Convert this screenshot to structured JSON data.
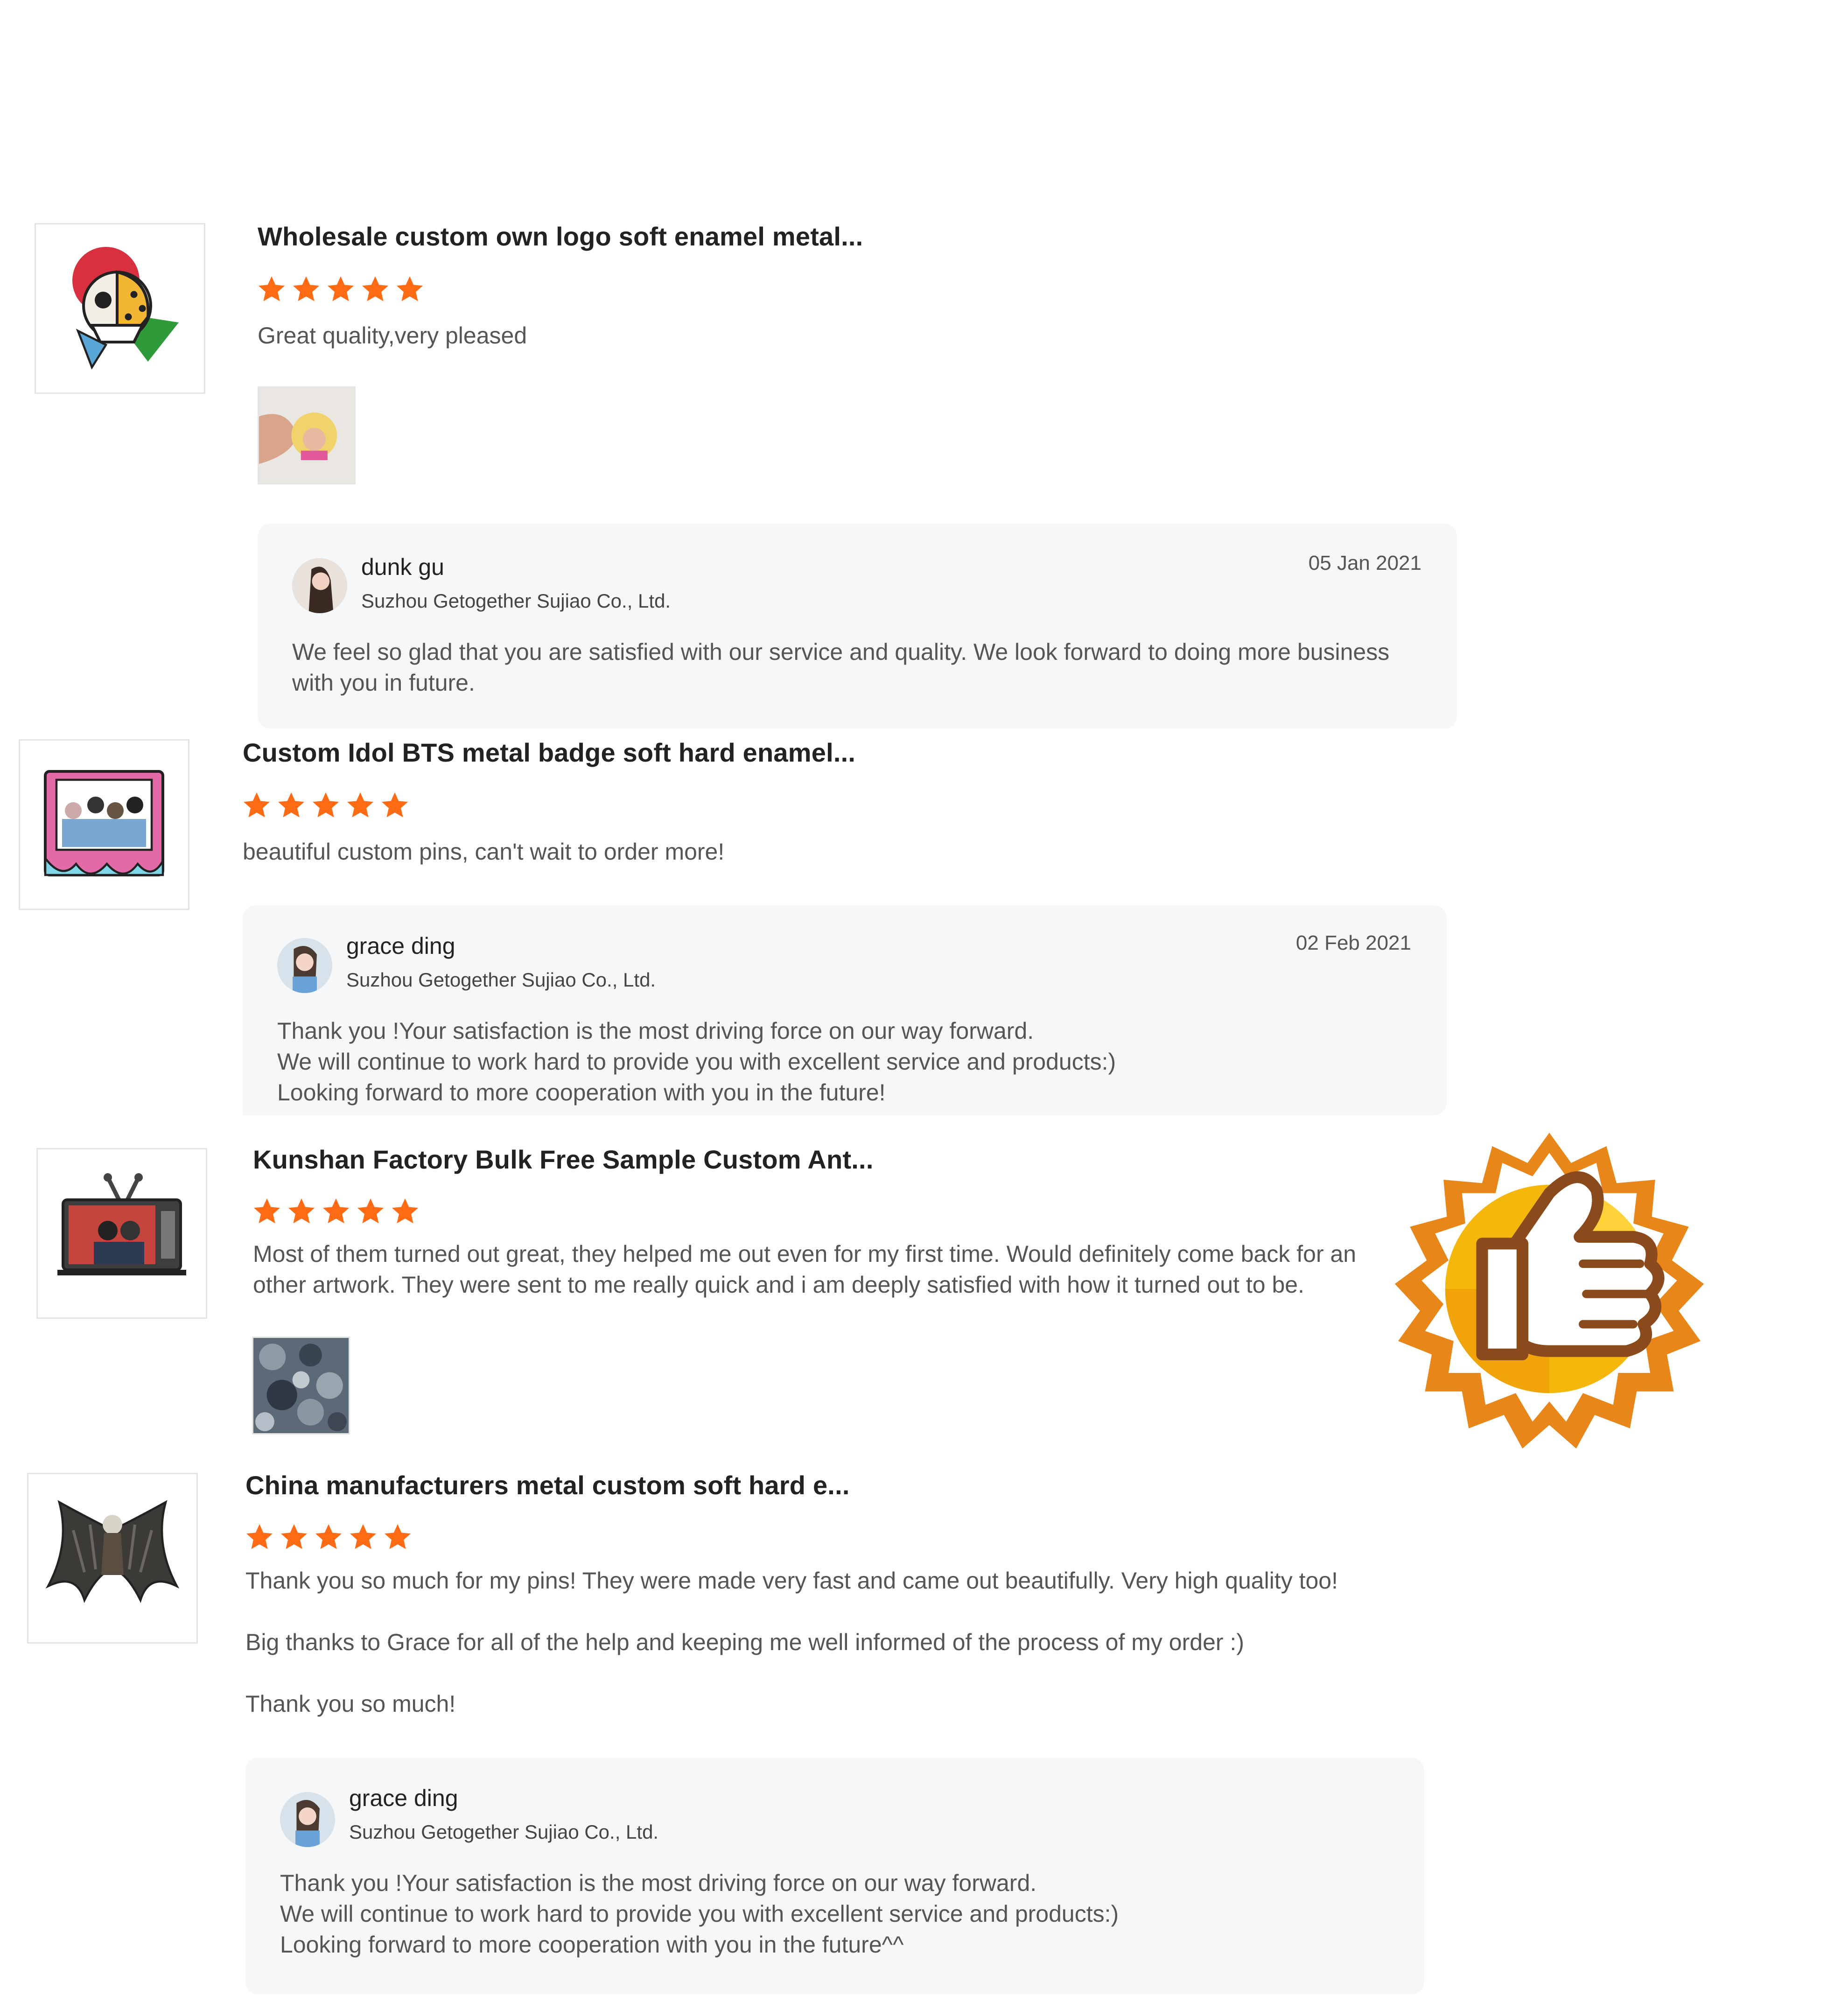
{
  "colors": {
    "star": "#ff6a14",
    "reply_bg": "#f6f7f9",
    "badge_gold": "#f5b70c",
    "badge_orange": "#e8861a"
  },
  "reviews": [
    {
      "title": "Wholesale custom own logo soft enamel metal...",
      "rating": 5,
      "text": "Great quality,very pleased",
      "thumb_icon": "skull-leopard-pin-icon",
      "photo_icon": "blonde-pin-in-hand-photo",
      "reply": {
        "name": "dunk gu",
        "company": "Suzhou Getogether Sujiao Co., Ltd.",
        "date": "05 Jan 2021",
        "lines": [
          "We feel so glad that you are satisfied with our service and quality. We look forward to doing more business",
          "with you in future."
        ]
      }
    },
    {
      "title": "Custom Idol BTS metal badge soft hard enamel...",
      "rating": 5,
      "text": "beautiful custom pins, can't wait to order more!",
      "thumb_icon": "bts-photo-frame-pin-icon",
      "reply": {
        "name": "grace ding",
        "company": "Suzhou Getogether Sujiao Co., Ltd.",
        "date": "02 Feb 2021",
        "lines": [
          "Thank you !Your satisfaction is the most driving force on our way forward.",
          "We will continue to work hard to provide you with excellent service and products:)",
          "Looking forward to more cooperation with you in the future!"
        ]
      }
    },
    {
      "title": "Kunshan Factory Bulk Free Sample Custom Ant...",
      "rating": 5,
      "text_lines": [
        "Most of them turned out great, they helped me out even for my first time. Would definitely come back for an",
        "other artwork. They were sent to me really quick and i am deeply satisfied with how it turned out to be."
      ],
      "thumb_icon": "tv-pin-icon",
      "photo_icon": "camo-pins-photo"
    },
    {
      "title": "China manufacturers metal custom soft hard e...",
      "rating": 5,
      "text_lines": [
        "Thank you so much for my pins! They were made very fast and came out beautifully. Very high quality too!",
        "",
        "Big thanks to Grace for all of the help and keeping me well informed of the process of my order :)",
        "",
        "Thank you so much!"
      ],
      "thumb_icon": "winged-figure-pin-icon",
      "reply": {
        "name": "grace ding",
        "company": "Suzhou Getogether Sujiao Co., Ltd.",
        "lines": [
          "Thank you !Your satisfaction is the most driving force on our way forward.",
          "We will continue to work hard to provide you with excellent service and products:)",
          "Looking forward to more cooperation with you in the future^^"
        ]
      }
    }
  ],
  "badge_icon": "thumbs-up-badge-icon"
}
